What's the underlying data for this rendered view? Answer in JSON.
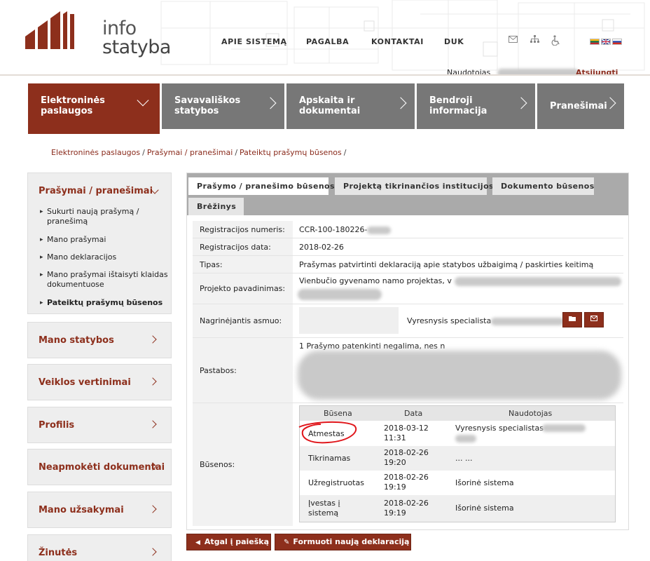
{
  "brand": {
    "line1": "info",
    "line2": "statyba"
  },
  "topnav": [
    {
      "label": "APIE SISTEMĄ"
    },
    {
      "label": "PAGALBA"
    },
    {
      "label": "KONTAKTAI"
    },
    {
      "label": "DUK"
    }
  ],
  "top_icons": [
    "mail-icon",
    "sitemap-icon",
    "accessibility-icon"
  ],
  "languages": [
    "lt",
    "en",
    "ru"
  ],
  "user": {
    "label": "Naudotojas",
    "logout": "Atsijungti"
  },
  "mainnav": [
    {
      "line1": "Elektroninės",
      "line2": "paslaugos",
      "active": true
    },
    {
      "line1": "Savavališkos",
      "line2": "statybos"
    },
    {
      "line1": "Apskaita ir",
      "line2": "dokumentai"
    },
    {
      "line1": "Bendroji",
      "line2": "informacija"
    },
    {
      "line1": "Pranešimai",
      "line2": ""
    }
  ],
  "breadcrumb": [
    "Elektroninės paslaugos",
    "Prašymai / pranešimai",
    "Pateiktų prašymų būsenos"
  ],
  "sidebar": {
    "open_section": {
      "title": "Prašymai / pranešimai",
      "items": [
        {
          "label": "Sukurti naują prašymą / pranešimą"
        },
        {
          "label": "Mano prašymai"
        },
        {
          "label": "Mano deklaracijos"
        },
        {
          "label": "Mano prašymai ištaisyti klaidas dokumentuose"
        },
        {
          "label": "Pateiktų prašymų būsenos",
          "current": true
        }
      ]
    },
    "sections": [
      {
        "label": "Mano statybos"
      },
      {
        "label": "Veiklos vertinimai"
      },
      {
        "label": "Profilis"
      },
      {
        "label": "Neapmokėti dokumentai"
      },
      {
        "label": "Mano užsakymai"
      },
      {
        "label": "Žinutės"
      }
    ]
  },
  "tabs": [
    {
      "label": "Prašymo / pranešimo būsenos",
      "active": true
    },
    {
      "label": "Projektą tikrinančios institucijos"
    },
    {
      "label": "Dokumento būsenos"
    },
    {
      "label": "Brėžinys"
    }
  ],
  "details": {
    "reg_no_label": "Registracijos numeris:",
    "reg_no_value": "CCR-100-180226-",
    "reg_date_label": "Registracijos data:",
    "reg_date_value": "2018-02-26",
    "type_label": "Tipas:",
    "type_value": "Prašymas patvirtinti deklaraciją apie statybos užbaigimą / paskirties keitimą",
    "project_label": "Projekto pavadinimas:",
    "project_value": "Vienbučio gyvenamo namo projektas, v",
    "examiner_label": "Nagrinėjantis asmuo:",
    "examiner_value": "Vyresnysis specialista",
    "notes_label": "Pastabos:",
    "notes_value": "1 Prašymo patenkinti negalima, nes n",
    "statuses_label": "Būsenos:"
  },
  "status_table": {
    "headers": [
      "Būsena",
      "Data",
      "Naudotojas"
    ],
    "rows": [
      {
        "status": "Atmestas",
        "date": "2018-03-12",
        "time": "11:31",
        "user": "Vyresnysis specialistas"
      },
      {
        "status": "Tikrinamas",
        "date": "2018-02-26",
        "time": "19:20",
        "user": "... ..."
      },
      {
        "status": "Užregistruotas",
        "date": "2018-02-26",
        "time": "19:19",
        "user": "Išorinė sistema"
      },
      {
        "status": "Įvestas į",
        "status2": "sistemą",
        "date": "2018-02-26",
        "time": "19:19",
        "user": "Išorinė sistema"
      }
    ]
  },
  "buttons": {
    "back": "Atgal į paiešką",
    "new_decl": "Formuoti naują deklaraciją"
  },
  "colors": {
    "brand": "#8d2f1c",
    "nav_gray": "#777777",
    "annotation": "#e0161b"
  }
}
